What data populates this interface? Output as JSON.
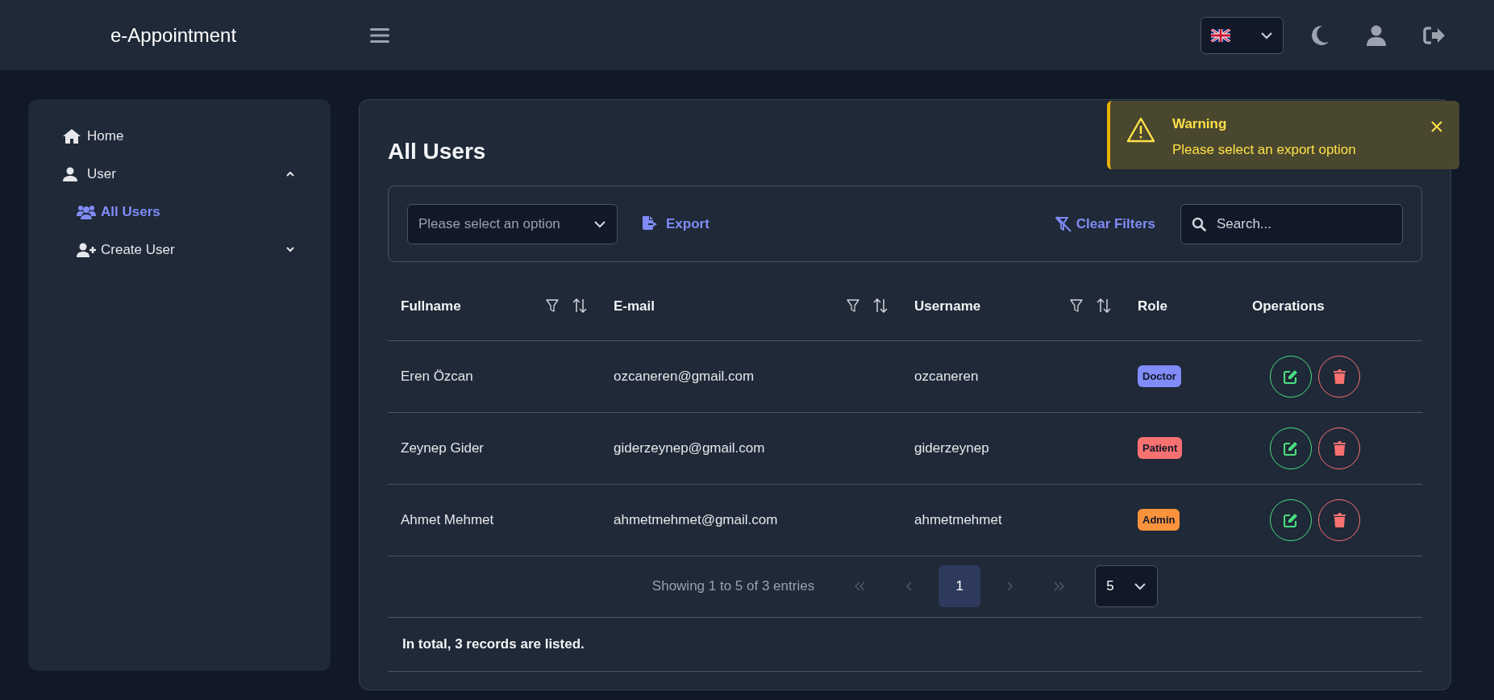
{
  "header": {
    "brand": "e-Appointment"
  },
  "sidebar": {
    "items": [
      {
        "label": "Home",
        "selected": false
      },
      {
        "label": "User",
        "selected": false,
        "expanded": true,
        "children": [
          {
            "label": "All Users",
            "selected": true
          },
          {
            "label": "Create User",
            "selected": false,
            "expanded": false
          }
        ]
      }
    ]
  },
  "page": {
    "title": "All Users"
  },
  "toolbar": {
    "export_select": {
      "placeholder": "Please select an option"
    },
    "export_button": "Export",
    "clear_filters": "Clear Filters",
    "search": {
      "placeholder": "Search..."
    }
  },
  "table": {
    "columns": [
      {
        "label": "Fullname",
        "filter": true
      },
      {
        "label": "E-mail",
        "filter": true
      },
      {
        "label": "Username",
        "filter": true
      },
      {
        "label": "Role",
        "filter": false
      },
      {
        "label": "Operations",
        "filter": false
      }
    ],
    "rows": [
      {
        "fullname": "Eren Özcan",
        "email": "ozcaneren@gmail.com",
        "username": "ozcaneren",
        "role": "Doctor",
        "color": "#818cf8"
      },
      {
        "fullname": "Zeynep Gider",
        "email": "giderzeynep@gmail.com",
        "username": "giderzeynep",
        "role": "Patient",
        "color": "#f87171"
      },
      {
        "fullname": "Ahmet Mehmet",
        "email": "ahmetmehmet@gmail.com",
        "username": "ahmetmehmet",
        "role": "Admin",
        "color": "#fb923c"
      }
    ]
  },
  "pagination": {
    "summary": "Showing 1 to 5 of 3 entries",
    "first_disabled": true,
    "prev_disabled": true,
    "pages": [
      {
        "label": "1",
        "selected": true
      }
    ],
    "next_disabled": true,
    "last_disabled": true,
    "per_page": "5"
  },
  "footer_note": "In total, 3 records are listed.",
  "toast": {
    "title": "Warning",
    "message": "Please select an export option"
  }
}
